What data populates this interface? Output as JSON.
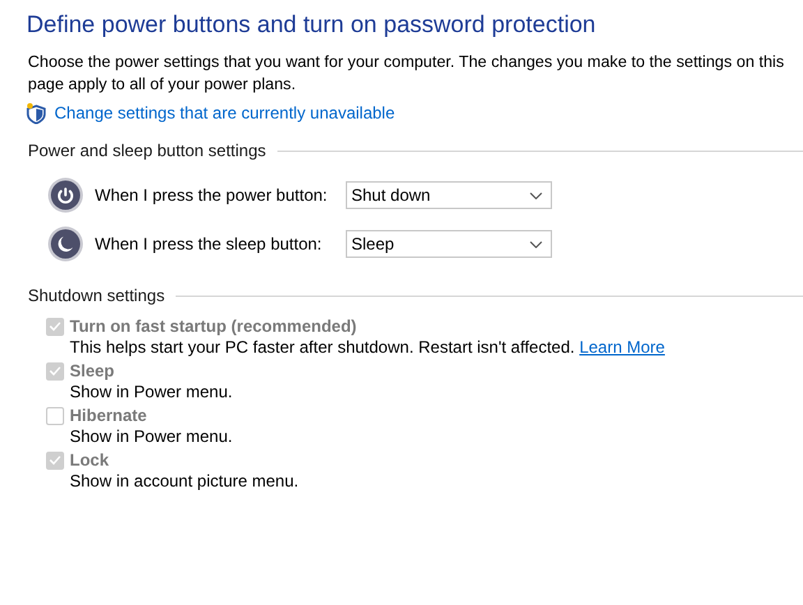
{
  "title": "Define power buttons and turn on password protection",
  "description_lines": [
    "Choose the power settings that you want for your computer. The changes you make to the settings on this",
    "page apply to all of your power plans."
  ],
  "admin_link": "Change settings that are currently unavailable",
  "power_section": {
    "heading": "Power and sleep button settings",
    "rows": [
      {
        "kind": "power",
        "label": "When I press the power button:",
        "value": "Shut down"
      },
      {
        "kind": "sleep",
        "label": "When I press the sleep button:",
        "value": "Sleep"
      }
    ]
  },
  "shutdown_section": {
    "heading": "Shutdown settings",
    "options": [
      {
        "label": "Turn on fast startup (recommended)",
        "checked": true,
        "disabled": true,
        "description": "This helps start your PC faster after shutdown. Restart isn't affected.",
        "link": "Learn More"
      },
      {
        "label": "Sleep",
        "checked": true,
        "disabled": true,
        "description": "Show in Power menu."
      },
      {
        "label": "Hibernate",
        "checked": false,
        "disabled": true,
        "description": "Show in Power menu."
      },
      {
        "label": "Lock",
        "checked": true,
        "disabled": true,
        "description": "Show in account picture menu."
      }
    ]
  }
}
